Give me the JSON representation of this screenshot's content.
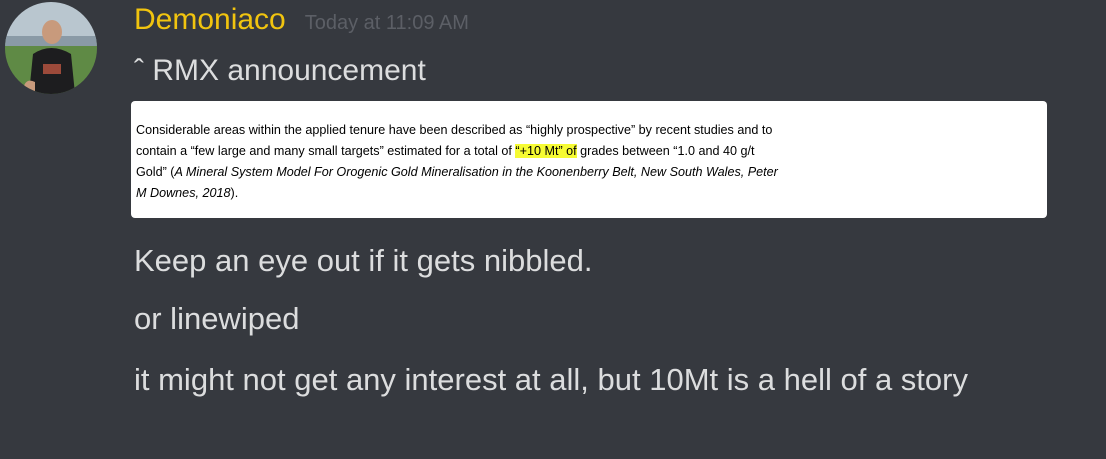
{
  "message": {
    "username": "Demoniaco",
    "timestamp": "Today at 11:09 AM",
    "lines": [
      "ˆ RMX announcement",
      "Keep an eye out if it gets nibbled.",
      "or linewiped",
      "it might not get any interest at all, but 10Mt is a hell of a story"
    ]
  },
  "attachment": {
    "line1": "Considerable areas within the applied tenure have been described as “highly prospective” by recent studies and to",
    "line2_before": "contain a “few large and many small targets” estimated for a total of",
    "line2_highlight": "“+10 Mt” of",
    "line2_after": " grades between “1.0 and 40 g/t",
    "line3_start": "Gold” (",
    "line3_italic": "A Mineral System Model For Orogenic Gold Mineralisation in the Koonenberry Belt, New South Wales, Peter",
    "line4_italic": "M Downes, 2018",
    "line4_end": ")."
  },
  "colors": {
    "background": "#36393f",
    "username": "#f1c40f",
    "timestamp": "#5c5f66",
    "text": "#dcddde",
    "highlight": "#f6fb33"
  }
}
